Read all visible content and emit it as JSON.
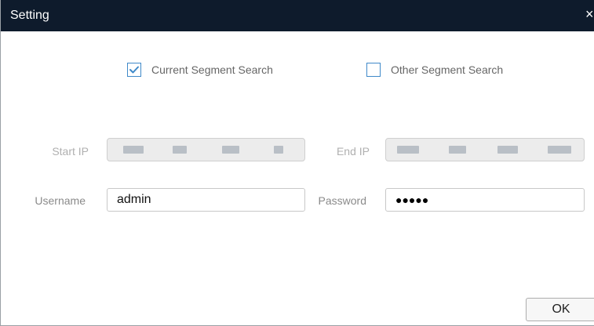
{
  "window": {
    "title": "Setting",
    "close_glyph": "×"
  },
  "search_mode": {
    "current": {
      "label": "Current Segment Search",
      "checked": true
    },
    "other": {
      "label": "Other Segment Search",
      "checked": false
    }
  },
  "fields": {
    "start_ip": {
      "label": "Start IP",
      "value_redacted": true
    },
    "end_ip": {
      "label": "End IP",
      "value_redacted": true
    },
    "username": {
      "label": "Username",
      "value": "admin"
    },
    "password": {
      "label": "Password",
      "masked_value": "●●●●●"
    }
  },
  "buttons": {
    "ok": "OK"
  },
  "colors": {
    "titlebar": "#0e1b2c",
    "checkbox_border": "#3f89c9",
    "checkmark": "#3f89c9"
  },
  "icons": {
    "close": "close-icon",
    "check": "checkmark-icon"
  }
}
